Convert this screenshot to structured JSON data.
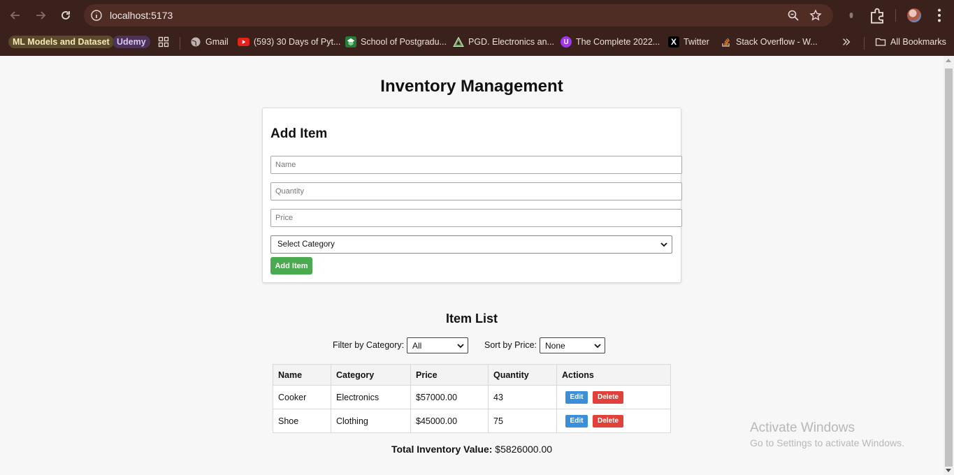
{
  "browser": {
    "url": "localhost:5173",
    "bookmarks": [
      {
        "label": "ML Models and Dataset",
        "icon": "pill-badge"
      },
      {
        "label": "Udemy",
        "icon": "pill-badge"
      },
      {
        "label": "Gmail",
        "icon": "globe-icon"
      },
      {
        "label": "(593) 30 Days of Pyt...",
        "icon": "youtube-icon"
      },
      {
        "label": "School of Postgradu...",
        "icon": "school-icon"
      },
      {
        "label": "PGD. Electronics an...",
        "icon": "triangle-icon"
      },
      {
        "label": "The Complete 2022...",
        "icon": "udemy-icon"
      },
      {
        "label": "Twitter",
        "icon": "x-icon"
      },
      {
        "label": "Stack Overflow - W...",
        "icon": "stackoverflow-icon"
      }
    ],
    "all_bookmarks": "All Bookmarks"
  },
  "page": {
    "title": "Inventory Management",
    "form": {
      "heading": "Add Item",
      "name_placeholder": "Name",
      "quantity_placeholder": "Quantity",
      "price_placeholder": "Price",
      "category_selected": "Select Category",
      "submit_label": "Add Item"
    },
    "list": {
      "heading": "Item List",
      "filter_label": "Filter by Category:",
      "filter_value": "All",
      "sort_label": "Sort by Price:",
      "sort_value": "None",
      "columns": [
        "Name",
        "Category",
        "Price",
        "Quantity",
        "Actions"
      ],
      "rows": [
        {
          "name": "Cooker",
          "category": "Electronics",
          "price": "$57000.00",
          "quantity": "43",
          "edit": "Edit",
          "delete": "Delete"
        },
        {
          "name": "Shoe",
          "category": "Clothing",
          "price": "$45000.00",
          "quantity": "75",
          "edit": "Edit",
          "delete": "Delete"
        }
      ]
    },
    "total_label": "Total Inventory Value:",
    "total_value": "$5826000.00"
  },
  "watermark": {
    "line1": "Activate Windows",
    "line2": "Go to Settings to activate Windows."
  },
  "colors": {
    "chrome_bg": "#3b211c",
    "add_button": "#4aaa4f",
    "edit_button": "#3a8fd8",
    "delete_button": "#e0413b"
  }
}
